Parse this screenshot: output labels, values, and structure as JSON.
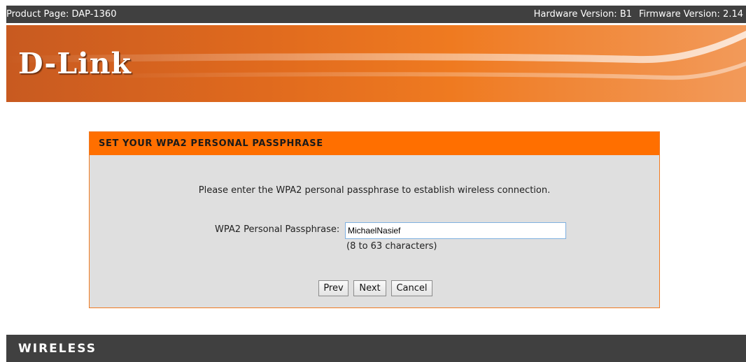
{
  "topbar": {
    "product_page": "Product Page: DAP-1360",
    "hardware_version": "Hardware Version: B1",
    "firmware_version": "Firmware Version: 2.14"
  },
  "banner": {
    "logo": "D-Link"
  },
  "panel": {
    "title": "SET YOUR WPA2 PERSONAL PASSPHRASE",
    "intro": "Please enter the WPA2 personal passphrase to establish wireless connection.",
    "passphrase_label": "WPA2 Personal Passphrase:",
    "passphrase_value": "MichaelNasief",
    "hint": "(8 to 63 characters)",
    "buttons": {
      "prev": "Prev",
      "next": "Next",
      "cancel": "Cancel"
    }
  },
  "footer": {
    "label": "WIRELESS"
  },
  "colors": {
    "accent_orange": "#ff6f00",
    "dark_bar": "#404040",
    "panel_bg": "#dfdfdf"
  }
}
